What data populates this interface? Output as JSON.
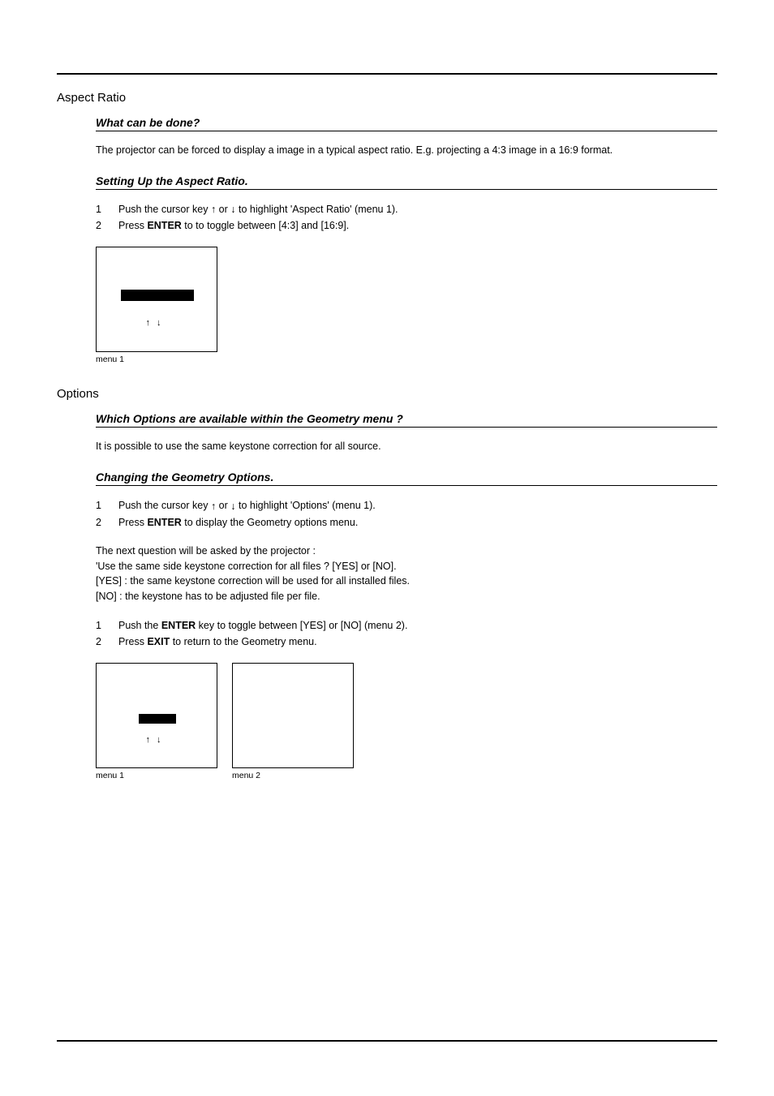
{
  "aspect": {
    "title": "Aspect Ratio",
    "h1": "What can be done?",
    "p1": "The projector can be forced to display a image in a typical aspect ratio.   E.g. projecting a 4:3 image in a 16:9 format.",
    "h2": "Setting Up the Aspect Ratio.",
    "steps": [
      {
        "n": "1",
        "pre": "Push the cursor key ",
        "mid": " or ",
        "post": " to highlight 'Aspect Ratio' (menu 1)."
      },
      {
        "n": "2",
        "pre": "Press ",
        "bold": "ENTER",
        "post": " to to toggle between [4:3] and [16:9]."
      }
    ],
    "menu_caption": "menu 1"
  },
  "options": {
    "title": "Options",
    "h1": "Which Options are available within the Geometry menu ?",
    "p1": "It is possible to use the same keystone correction for all source.",
    "h2": "Changing the Geometry Options.",
    "stepsA": [
      {
        "n": "1",
        "pre": "Push the cursor key ",
        "mid": " or ",
        "post": " to highlight 'Options' (menu 1)."
      },
      {
        "n": "2",
        "pre": "Press ",
        "bold": "ENTER",
        "post": " to display the Geometry options menu."
      }
    ],
    "paraBlock": [
      "The next question will be asked by the projector :",
      "'Use the same side keystone correction for all files ? [YES] or [NO].",
      "[YES] : the same keystone correction will be used for all installed files.",
      "[NO] : the keystone has to be adjusted file per file."
    ],
    "stepsB": [
      {
        "n": "1",
        "pre": "Push the ",
        "bold": "ENTER",
        "post": " key to toggle between [YES] or [NO] (menu 2)."
      },
      {
        "n": "2",
        "pre": "Press ",
        "bold": "EXIT",
        "post": " to return to the Geometry menu."
      }
    ],
    "menu1_caption": "menu 1",
    "menu2_caption": "menu 2"
  },
  "glyphs": {
    "up": "↑",
    "down": "↓"
  }
}
